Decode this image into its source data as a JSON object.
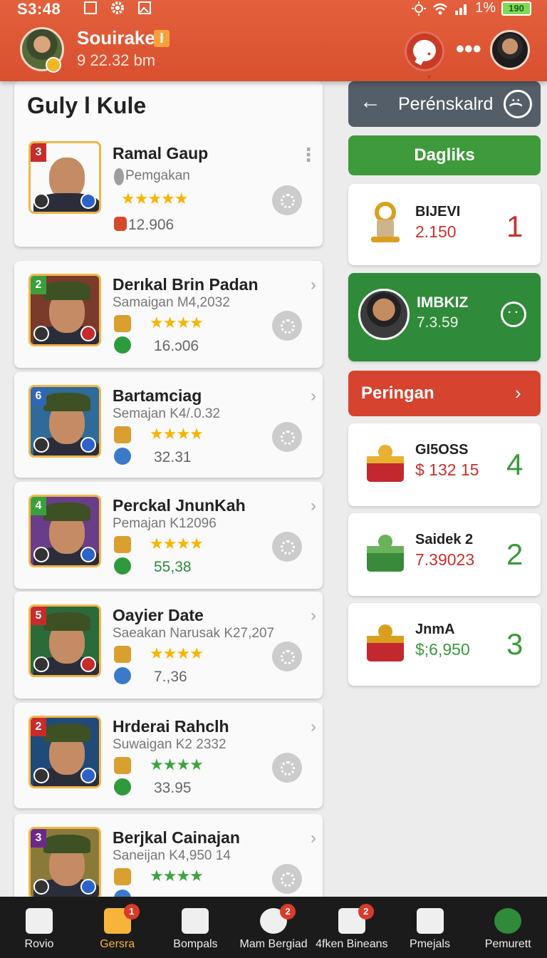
{
  "status_bar": {
    "time": "S3:48",
    "battery_percent": "1%",
    "battery_label": "190"
  },
  "header": {
    "user_name": "Souirake",
    "user_sub": "9 22.32 bm",
    "flag": "I"
  },
  "left": {
    "section_title": "Guly l Kule",
    "items": [
      {
        "rank": "3",
        "rank_color": "#c62c2c",
        "name": "Ramal Gaup",
        "sub": "Pemgakan",
        "stars": "★★★★★",
        "star_color": "yellow",
        "value": "12.906",
        "bg": "#8a6b4a"
      },
      {
        "rank": "2",
        "rank_color": "#3aa03c",
        "name": "Derıkal Brin Padan",
        "sub": "Samaigan M4,2032",
        "stars": "★★★★",
        "star_color": "yellow",
        "value": "16.ɔ06",
        "bg": "#7a3b2a"
      },
      {
        "rank": "6",
        "rank_color": "#2f66b7",
        "name": "Bartamciag",
        "sub": "Semajan K4/.0.32",
        "stars": "★★★★",
        "star_color": "yellow",
        "value": "32.31",
        "bg": "#2f6a9a"
      },
      {
        "rank": "4",
        "rank_color": "#3aa03c",
        "name": "Perckal JnunKah",
        "sub": "Pemajan K12096",
        "stars": "★★★★",
        "star_color": "yellow",
        "value": "55,38",
        "bg": "#6a3d8a"
      },
      {
        "rank": "5",
        "rank_color": "#c62c2c",
        "name": "Oayier Date",
        "sub": "Saeakan Narusak K27,207",
        "stars": "★★★★",
        "star_color": "yellow",
        "value": "7.,36",
        "bg": "#2b6b3a"
      },
      {
        "rank": "2",
        "rank_color": "#c62c2c",
        "name": "Hrderai Rahclh",
        "sub": "Suwaigan K2 2332",
        "stars": "★★★★",
        "star_color": "green",
        "value": "33.95",
        "bg": "#204a7a"
      },
      {
        "rank": "3",
        "rank_color": "#6a2a8a",
        "name": "Berjkal Cainajan",
        "sub": "Saneijan K4,950 14",
        "stars": "★★★★",
        "star_color": "green",
        "value": "",
        "bg": "#8a7a3a"
      }
    ]
  },
  "right": {
    "header_title": "Perénskalrd",
    "green_button": "Dagliks",
    "red_button": "Peringan",
    "top_card": {
      "name": "BIJEVI",
      "value": "2.150",
      "num": "1",
      "num_color": "#c9302c"
    },
    "profile_card": {
      "name": "IMBKIZ",
      "value": "7.3.59"
    },
    "cards": [
      {
        "name": "GI5OSS",
        "value": "$ 132 15",
        "value_color": "#c9302c",
        "num": "4",
        "num_color": "#3a9a3c"
      },
      {
        "name": "Saidek 2",
        "value": "7.39023",
        "value_color": "#c9302c",
        "num": "2",
        "num_color": "#3a9a3c"
      },
      {
        "name": "JnmA",
        "value": "$;6,950",
        "value_color": "#3a9a3c",
        "num": "3",
        "num_color": "#3a9a3c"
      }
    ]
  },
  "bottom_nav": [
    {
      "label": "Rovio",
      "badge": ""
    },
    {
      "label": "Gersra",
      "badge": "1"
    },
    {
      "label": "Bompals",
      "badge": ""
    },
    {
      "label": "Mam Bergiad",
      "badge": "2"
    },
    {
      "label": "4fken Bineans",
      "badge": "2"
    },
    {
      "label": "Pmejals",
      "badge": ""
    },
    {
      "label": "Pemurett",
      "badge": ""
    }
  ]
}
